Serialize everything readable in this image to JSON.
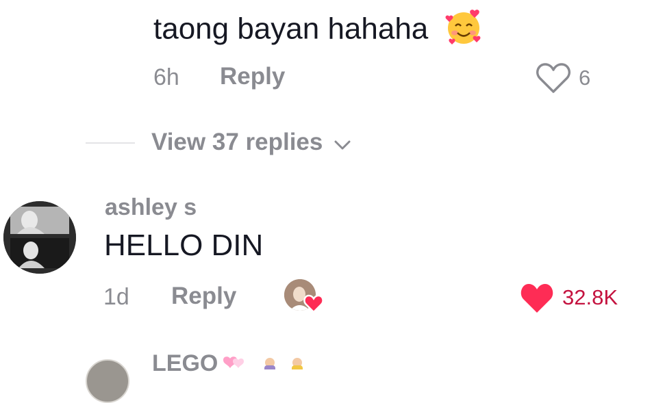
{
  "comments": [
    {
      "text": "taong bayan hahaha",
      "emoji": "smiling-face-with-hearts-icon",
      "time": "6h",
      "reply_label": "Reply",
      "like_count": "6",
      "liked": false
    },
    {
      "username": "ashley s",
      "text": "HELLO DIN",
      "time": "1d",
      "reply_label": "Reply",
      "like_count": "32.8K",
      "liked": true,
      "liked_by_creator": true
    }
  ],
  "view_replies_label": "View 37 replies",
  "next_comment": {
    "username_partial": "LEGO"
  },
  "colors": {
    "text_primary": "#161823",
    "text_secondary": "#8a8b91",
    "like_red": "#fe2c55",
    "like_count_red": "#c4123f"
  }
}
